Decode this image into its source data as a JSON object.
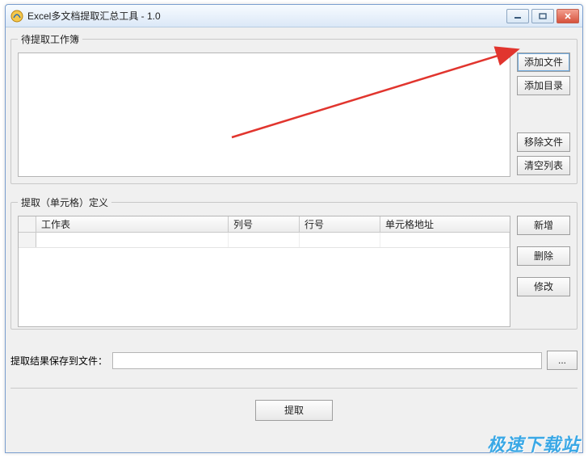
{
  "window": {
    "title": "Excel多文档提取汇总工具 - 1.0"
  },
  "groups": {
    "workbooks_legend": "待提取工作簿",
    "cells_legend": "提取（单元格）定义"
  },
  "buttons": {
    "add_file": "添加文件",
    "add_dir": "添加目录",
    "remove_file": "移除文件",
    "clear_list": "清空列表",
    "add_cell": "新增",
    "delete_cell": "删除",
    "edit_cell": "修改",
    "browse": "...",
    "extract": "提取"
  },
  "grid": {
    "headers": {
      "worksheet": "工作表",
      "col": "列号",
      "row": "行号",
      "addr": "单元格地址"
    },
    "rows": []
  },
  "save": {
    "label": "提取结果保存到文件：",
    "value": ""
  },
  "watermark": "极速下载站"
}
